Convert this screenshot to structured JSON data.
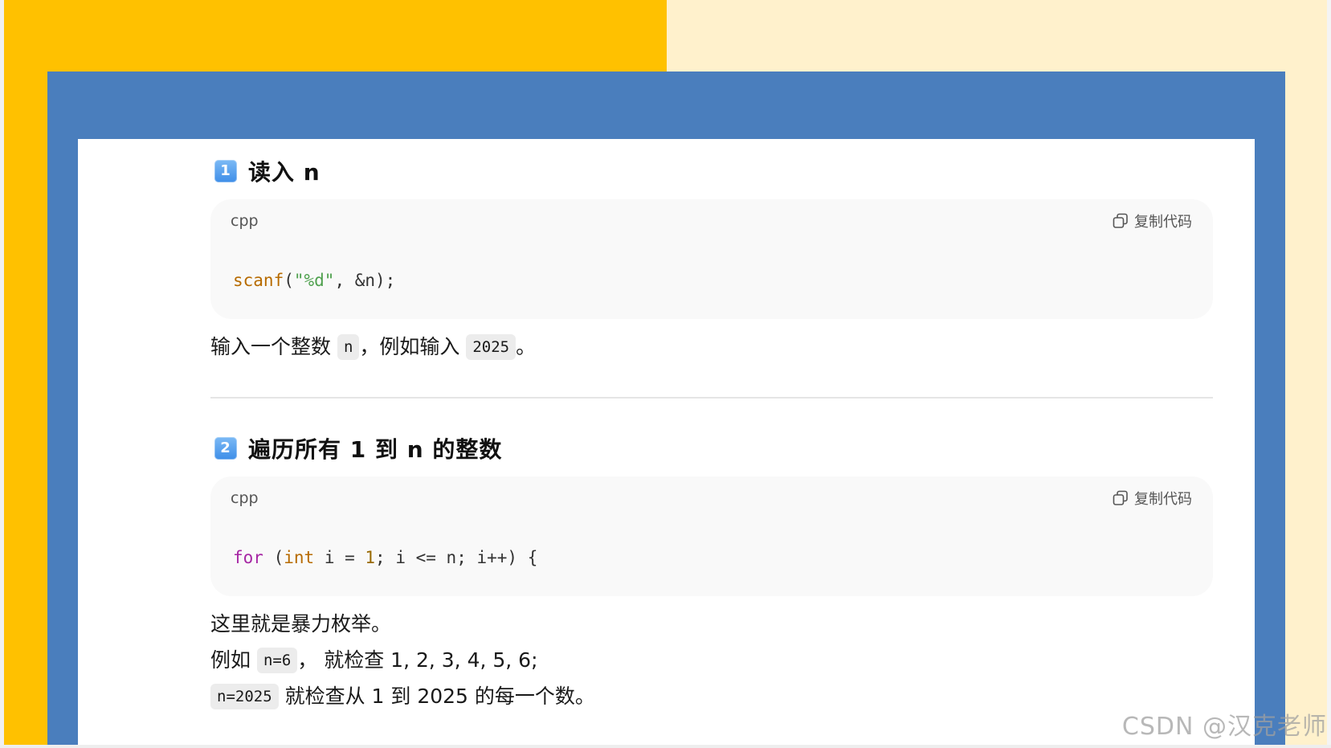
{
  "section1": {
    "badge": "1",
    "title": "读入 n",
    "code": {
      "lang": "cpp",
      "copy_label": "复制代码",
      "tokens": {
        "fn": "scanf",
        "p1": "(",
        "str": "\"%d\"",
        "rest": ", &n);"
      }
    },
    "para": {
      "t1": "输入一个整数 ",
      "c1": "n",
      "t2": "，例如输入 ",
      "c2": "2025",
      "t3": "。"
    }
  },
  "section2": {
    "badge": "2",
    "title": "遍历所有 1 到 n 的整数",
    "code": {
      "lang": "cpp",
      "copy_label": "复制代码",
      "tokens": {
        "kw": "for",
        "p1": " (",
        "type": "int",
        "p2": " i = ",
        "num": "1",
        "rest": "; i <= n; i++) {"
      }
    },
    "line1": "这里就是暴力枚举。",
    "line2": {
      "t1": "例如 ",
      "c1": "n=6",
      "t2": "， 就检查 1, 2, 3, 4, 5, 6;"
    },
    "line3": {
      "c1": "n=2025",
      "t1": " 就检查从 1 到 2025 的每一个数。"
    }
  },
  "watermark": "CSDN @汉克老师",
  "colors": {
    "yellow": "#ffc100",
    "cream": "#fff1cc",
    "blue": "#4a7ebd",
    "badge": "#3e8ee8"
  }
}
